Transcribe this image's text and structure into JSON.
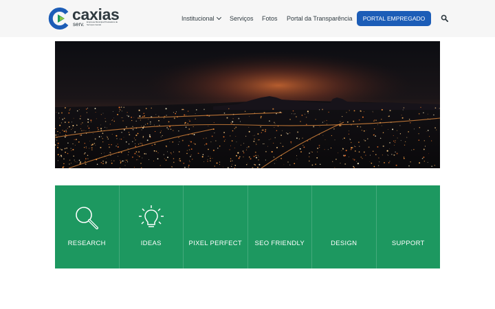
{
  "brand": {
    "name": "caxias",
    "sub": "serv.",
    "tagline": "Empresa Municipal Prestadora de Serviços Gerais",
    "colors": {
      "green": "#1c9a5a",
      "blue": "#1c5db7",
      "dark": "#2f3a40"
    }
  },
  "nav": {
    "items": [
      {
        "label": "Institucional",
        "has_dropdown": true
      },
      {
        "label": "Serviços"
      },
      {
        "label": "Fotos"
      },
      {
        "label": "Portal da Transparência"
      }
    ],
    "cta_label": "PORTAL EMPREGADO",
    "search_icon": "search-icon"
  },
  "hero": {
    "description_icon": "city-night-panorama"
  },
  "features": {
    "background": "#1d9860",
    "items": [
      {
        "label": "RESEARCH",
        "icon": "magnifier-icon"
      },
      {
        "label": "IDEAS",
        "icon": "lightbulb-icon"
      },
      {
        "label": "PIXEL PERFECT",
        "icon": ""
      },
      {
        "label": "SEO FRIENDLY",
        "icon": ""
      },
      {
        "label": "DESIGN",
        "icon": ""
      },
      {
        "label": "SUPPORT",
        "icon": ""
      }
    ]
  }
}
